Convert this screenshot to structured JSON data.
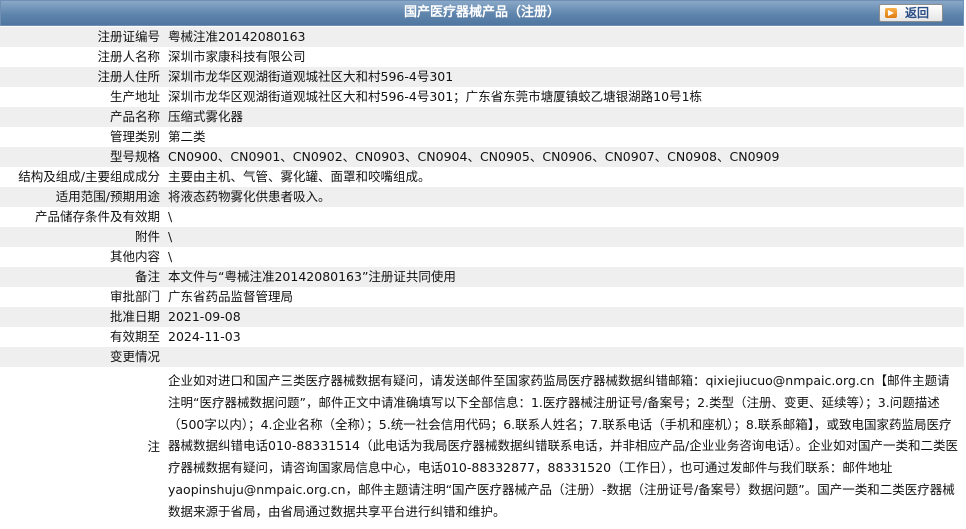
{
  "header": {
    "title": "国产医疗器械产品（注册）",
    "back_label": "返回"
  },
  "fields": [
    {
      "label": "注册证编号",
      "value": "粤械注准20142080163"
    },
    {
      "label": "注册人名称",
      "value": "深圳市家康科技有限公司"
    },
    {
      "label": "注册人住所",
      "value": "深圳市龙华区观湖街道观城社区大和村596-4号301"
    },
    {
      "label": "生产地址",
      "value": "深圳市龙华区观湖街道观城社区大和村596-4号301；广东省东莞市塘厦镇蛟乙塘银湖路10号1栋"
    },
    {
      "label": "产品名称",
      "value": "压缩式雾化器"
    },
    {
      "label": "管理类别",
      "value": "第二类"
    },
    {
      "label": "型号规格",
      "value": "CN0900、CN0901、CN0902、CN0903、CN0904、CN0905、CN0906、CN0907、CN0908、CN0909"
    },
    {
      "label": "结构及组成/主要组成成分",
      "value": "主要由主机、气管、雾化罐、面罩和咬嘴组成。"
    },
    {
      "label": "适用范围/预期用途",
      "value": "将液态药物雾化供患者吸入。"
    },
    {
      "label": "产品储存条件及有效期",
      "value": "\\"
    },
    {
      "label": "附件",
      "value": "\\"
    },
    {
      "label": "其他内容",
      "value": "\\"
    },
    {
      "label": "备注",
      "value": "本文件与“粤械注准20142080163”注册证共同使用"
    },
    {
      "label": "审批部门",
      "value": "广东省药品监督管理局"
    },
    {
      "label": "批准日期",
      "value": "2021-09-08"
    },
    {
      "label": "有效期至",
      "value": "2024-11-03"
    }
  ],
  "change_label": "变更情况",
  "change_value": "",
  "note": {
    "label": "注",
    "text": "企业如对进口和国产三类医疗器械数据有疑问，请发送邮件至国家药监局医疗器械数据纠错邮箱：qixiejiucuo@nmpaic.org.cn【邮件主题请注明“医疗器械数据问题”，邮件正文中请准确填写以下全部信息：1.医疗器械注册证号/备案号；2.类型（注册、变更、延续等）；3.问题描述（500字以内）；4.企业名称（全称）；5.统一社会信用代码；6.联系人姓名；7.联系电话（手机和座机）；8.联系邮箱】，或致电国家药监局医疗器械数据纠错电话010-88331514（此电话为我局医疗器械数据纠错联系电话，并非相应产品/企业业务咨询电话）。企业如对国产一类和二类医疗器械数据有疑问，请咨询国家局信息中心，电话010-88332877，88331520（工作日），也可通过发邮件与我们联系：邮件地址yaopinshuju@nmpaic.org.cn，邮件主题请注明“国产医疗器械产品（注册）-数据（注册证号/备案号）数据问题”。国产一类和二类医疗器械数据来源于省局，由省局通过数据共享平台进行纠错和维护。"
  }
}
